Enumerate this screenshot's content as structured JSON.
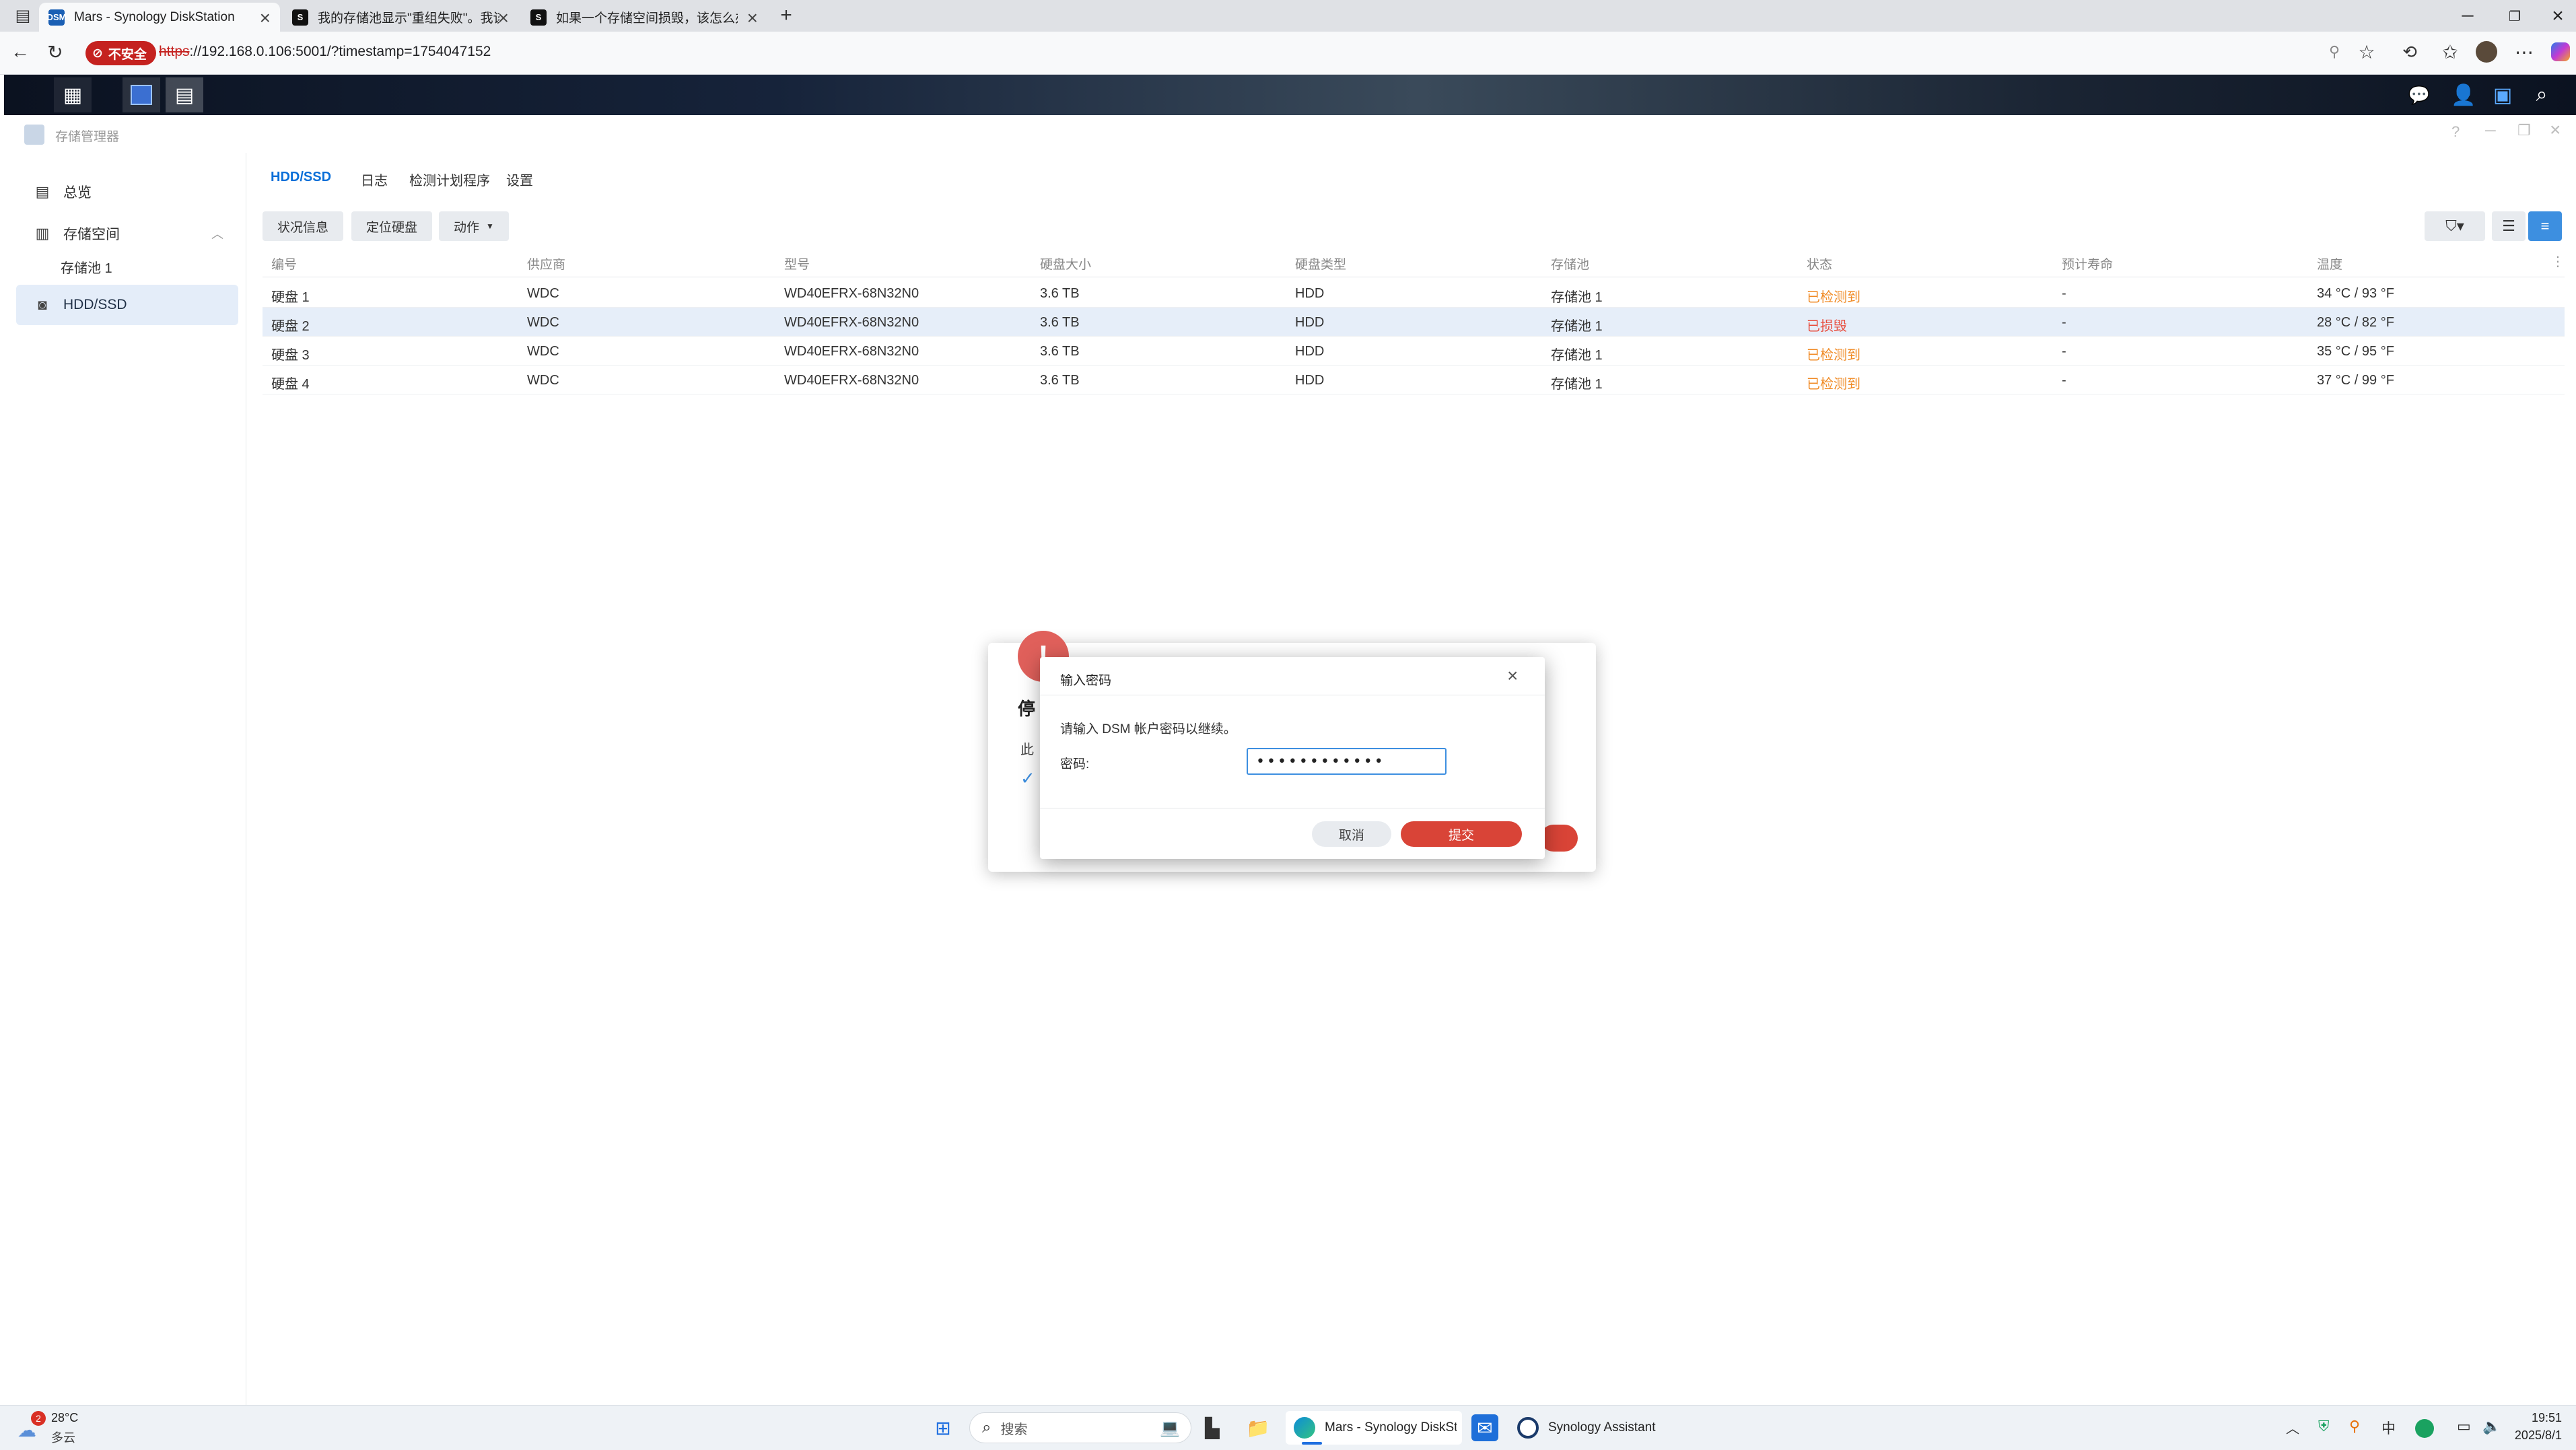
{
  "browser": {
    "tabs": [
      {
        "title": "Mars - Synology DiskStation",
        "favicon": "DSM",
        "active": true
      },
      {
        "title": "我的存储池显示\"重组失败\"。我该",
        "favicon": "S",
        "active": false
      },
      {
        "title": "如果一个存储空间损毁，该怎么办",
        "favicon": "S",
        "active": false
      }
    ],
    "new_tab_icon": "plus-icon",
    "security_label": "不安全",
    "url_protocol": "https",
    "url_rest": "://192.168.0.106:5001/?timestamp=1754047152"
  },
  "app": {
    "title": "存储管理器",
    "sidebar": {
      "items": [
        {
          "label": "总览",
          "icon": "overview-icon"
        },
        {
          "label": "存储空间",
          "icon": "storage-icon"
        },
        {
          "label": "存储池 1",
          "icon": ""
        },
        {
          "label": "HDD/SSD",
          "icon": "disk-icon"
        }
      ]
    },
    "tabs": [
      "HDD/SSD",
      "日志",
      "检测计划程序",
      "设置"
    ],
    "toolbar": {
      "status_info": "状况信息",
      "locate_disk": "定位硬盘",
      "action": "动作"
    },
    "table": {
      "headers": [
        "编号",
        "供应商",
        "型号",
        "硬盘大小",
        "硬盘类型",
        "存储池",
        "状态",
        "预计寿命",
        "温度"
      ],
      "rows": [
        {
          "id": "硬盘 1",
          "vendor": "WDC",
          "model": "WD40EFRX-68N32N0",
          "size": "3.6 TB",
          "type": "HDD",
          "pool": "存储池 1",
          "status": "已检测到",
          "life": "-",
          "temp": "34 °C / 93 °F"
        },
        {
          "id": "硬盘 2",
          "vendor": "WDC",
          "model": "WD40EFRX-68N32N0",
          "size": "3.6 TB",
          "type": "HDD",
          "pool": "存储池 1",
          "status": "已损毁",
          "life": "-",
          "temp": "28 °C / 82 °F"
        },
        {
          "id": "硬盘 3",
          "vendor": "WDC",
          "model": "WD40EFRX-68N32N0",
          "size": "3.6 TB",
          "type": "HDD",
          "pool": "存储池 1",
          "status": "已检测到",
          "life": "-",
          "temp": "35 °C / 95 °F"
        },
        {
          "id": "硬盘 4",
          "vendor": "WDC",
          "model": "WD40EFRX-68N32N0",
          "size": "3.6 TB",
          "type": "HDD",
          "pool": "存储池 1",
          "status": "已检测到",
          "life": "-",
          "temp": "37 °C / 99 °F"
        }
      ]
    }
  },
  "bg_dialog": {
    "title_fragment": "停",
    "text_fragment": "此"
  },
  "password_dialog": {
    "title": "输入密码",
    "message": "请输入 DSM 帐户密码以继续。",
    "label": "密码:",
    "value": "••••••••••••",
    "cancel": "取消",
    "submit": "提交"
  },
  "taskbar": {
    "weather_temp": "28°C",
    "weather_desc": "多云",
    "weather_badge": "2",
    "search_placeholder": "搜索",
    "apps": [
      {
        "label": "Mars - Synology DiskSta"
      },
      {
        "label": "Synology Assistant"
      }
    ],
    "ime": "中",
    "time": "19:51",
    "date": "2025/8/1"
  },
  "colors": {
    "accent": "#0a6fd8",
    "warn": "#f08a24",
    "error": "#e84c3d",
    "submit": "#d94437"
  }
}
